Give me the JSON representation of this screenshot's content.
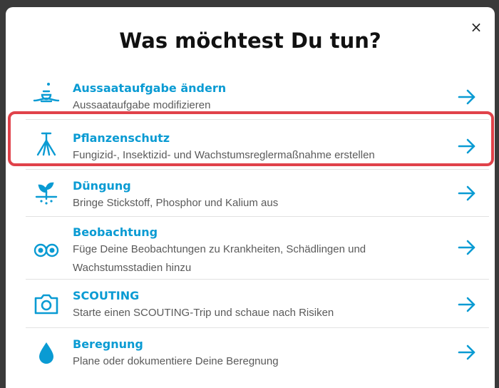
{
  "dialog": {
    "title": "Was möchtest Du tun?",
    "close_label": "×"
  },
  "items": [
    {
      "label": "Aussaataufgabe ändern",
      "desc": "Aussaataufgabe modifizieren",
      "icon": "seed-sowing-icon"
    },
    {
      "label": "Pflanzenschutz",
      "desc": "Fungizid-, Insektizid- und Wachstumsreglermaßnahme erstellen",
      "icon": "sprayer-icon"
    },
    {
      "label": "Düngung",
      "desc": "Bringe Stickstoff, Phosphor und Kalium aus",
      "icon": "fertilizer-icon"
    },
    {
      "label": "Beobachtung",
      "desc": "Füge Deine Beobachtungen zu Krankheiten, Schädlingen und Wachstumsstadien hinzu",
      "icon": "binoculars-icon"
    },
    {
      "label": "SCOUTING",
      "desc": "Starte einen SCOUTING-Trip und schaue nach Risiken",
      "icon": "camera-icon"
    },
    {
      "label": "Beregnung",
      "desc": "Plane oder dokumentiere Deine Beregnung",
      "icon": "water-drop-icon"
    }
  ],
  "colors": {
    "accent": "#0a9bd3",
    "highlight": "#e0424a"
  }
}
